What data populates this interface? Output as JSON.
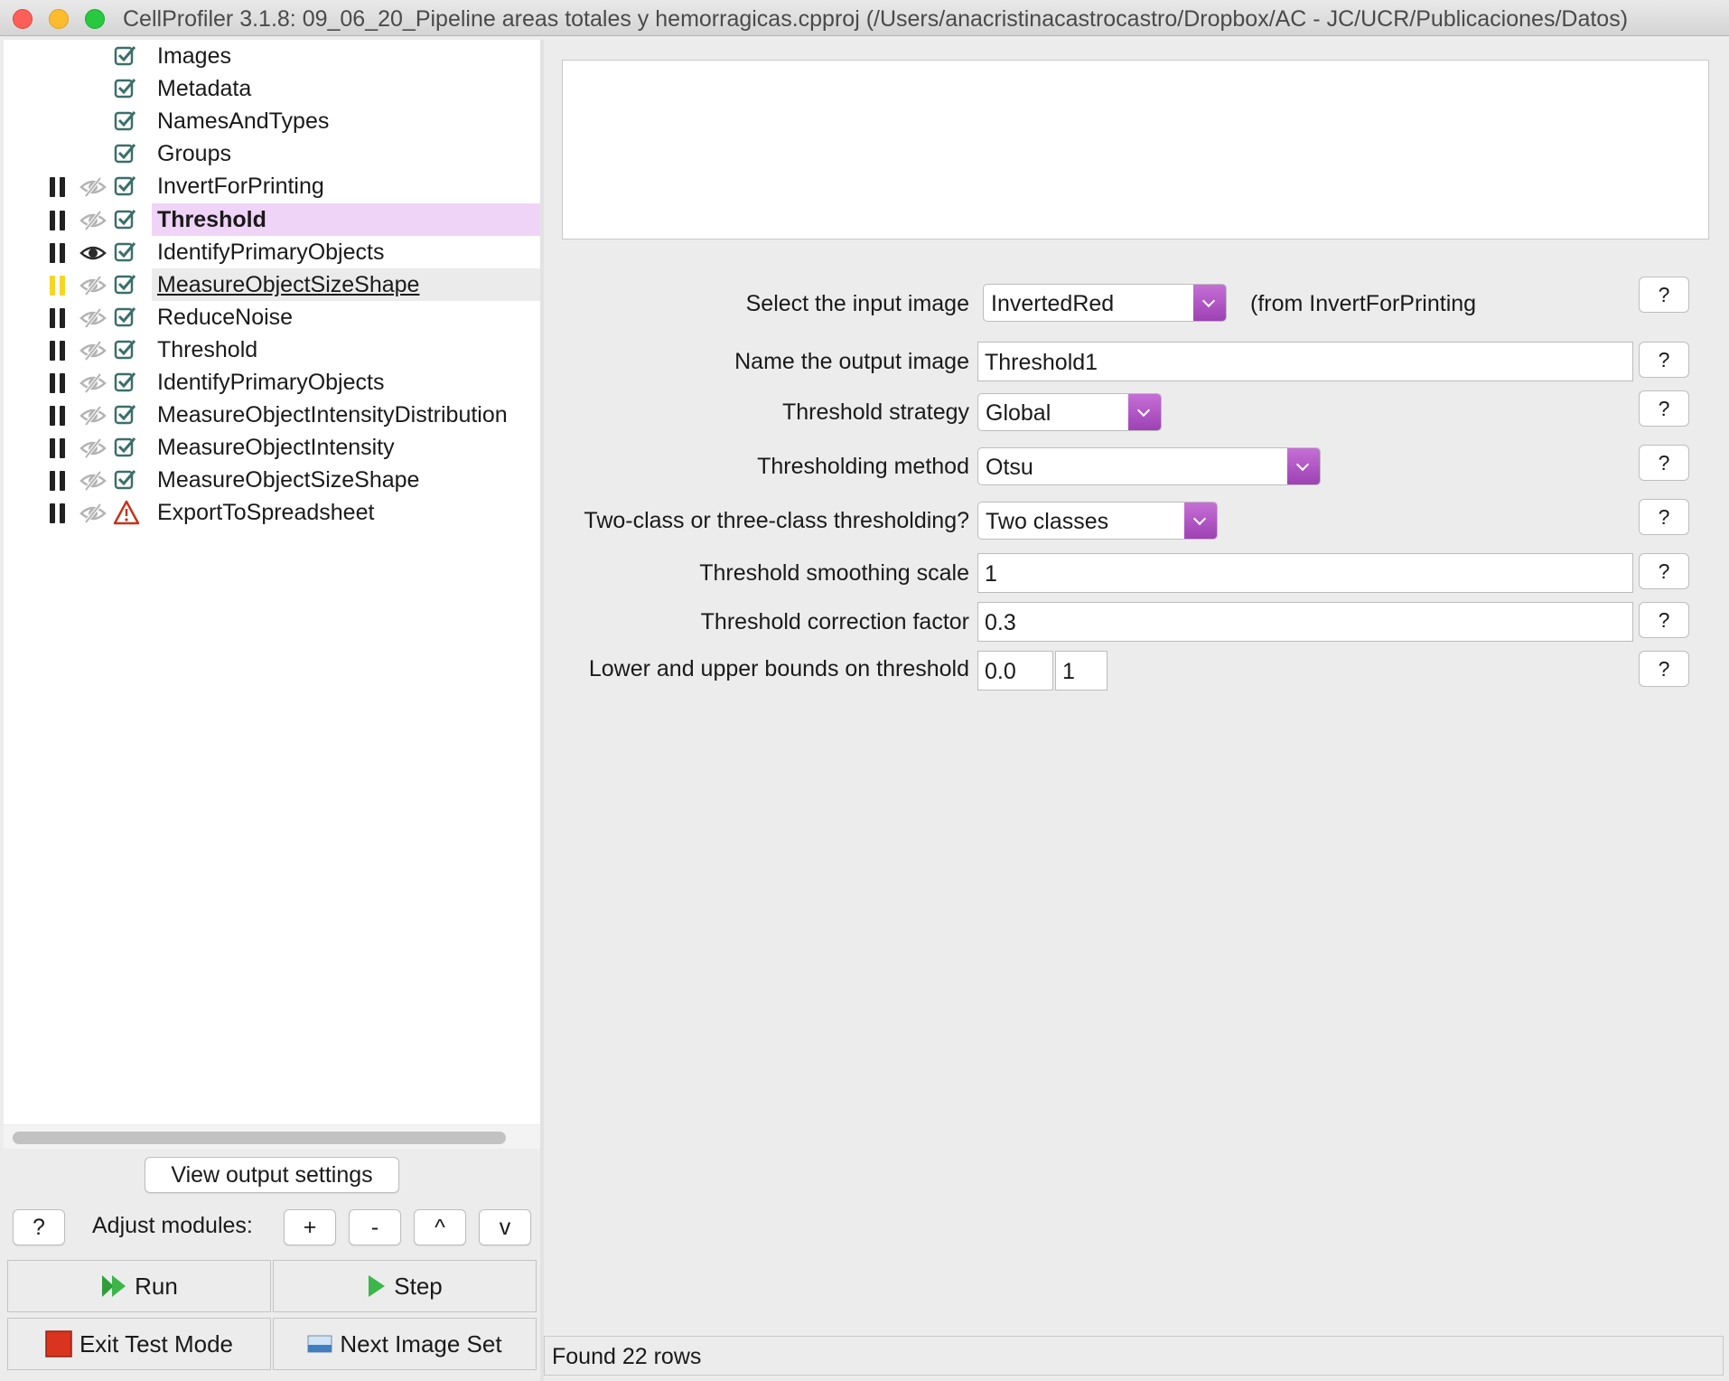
{
  "window": {
    "title": "CellProfiler 3.1.8: 09_06_20_Pipeline areas totales y hemorragicas.cpproj (/Users/anacristinacastrocastro/Dropbox/AC - JC/UCR/Publicaciones/Datos)"
  },
  "modules": [
    {
      "name": "Images",
      "pause": "none",
      "eye": "none",
      "status": "check"
    },
    {
      "name": "Metadata",
      "pause": "none",
      "eye": "none",
      "status": "check"
    },
    {
      "name": "NamesAndTypes",
      "pause": "none",
      "eye": "none",
      "status": "check"
    },
    {
      "name": "Groups",
      "pause": "none",
      "eye": "none",
      "status": "check"
    },
    {
      "name": "InvertForPrinting",
      "pause": "black",
      "eye": "hidden",
      "status": "check"
    },
    {
      "name": "Threshold",
      "pause": "black",
      "eye": "hidden",
      "status": "check",
      "state": "selected"
    },
    {
      "name": "IdentifyPrimaryObjects",
      "pause": "black",
      "eye": "visible",
      "status": "check"
    },
    {
      "name": "MeasureObjectSizeShape",
      "pause": "yellow",
      "eye": "hidden",
      "status": "check",
      "state": "hovered"
    },
    {
      "name": "ReduceNoise",
      "pause": "black",
      "eye": "hidden",
      "status": "check"
    },
    {
      "name": "Threshold",
      "pause": "black",
      "eye": "hidden",
      "status": "check"
    },
    {
      "name": "IdentifyPrimaryObjects",
      "pause": "black",
      "eye": "hidden",
      "status": "check"
    },
    {
      "name": "MeasureObjectIntensityDistribution",
      "pause": "black",
      "eye": "hidden",
      "status": "check"
    },
    {
      "name": "MeasureObjectIntensity",
      "pause": "black",
      "eye": "hidden",
      "status": "check"
    },
    {
      "name": "MeasureObjectSizeShape",
      "pause": "black",
      "eye": "hidden",
      "status": "check"
    },
    {
      "name": "ExportToSpreadsheet",
      "pause": "black",
      "eye": "hidden",
      "status": "warning"
    }
  ],
  "left_controls": {
    "view_output_settings": "View output settings",
    "help": "?",
    "adjust_label": "Adjust modules:",
    "add": "+",
    "remove": "-",
    "move_up": "^",
    "move_down": "v",
    "run": "Run",
    "step": "Step",
    "exit_test_mode": "Exit Test Mode",
    "next_image_set": "Next Image Set"
  },
  "settings": {
    "input_image": {
      "label": "Select the input image",
      "value": "InvertedRed",
      "source": "(from InvertForPrinting"
    },
    "output_image": {
      "label": "Name the output image",
      "value": "Threshold1"
    },
    "strategy": {
      "label": "Threshold strategy",
      "value": "Global"
    },
    "method": {
      "label": "Thresholding method",
      "value": "Otsu"
    },
    "classes": {
      "label": "Two-class or three-class thresholding?",
      "value": "Two classes"
    },
    "smoothing": {
      "label": "Threshold smoothing scale",
      "value": "1"
    },
    "correction": {
      "label": "Threshold correction factor",
      "value": "0.3"
    },
    "bounds": {
      "label": "Lower and upper bounds on threshold",
      "lower": "0.0",
      "upper": "1"
    },
    "help": "?"
  },
  "status": {
    "text": "Found 22 rows"
  },
  "colors": {
    "selected_row": "#efd4f7",
    "dropdown_accent": "#b25ac6"
  }
}
